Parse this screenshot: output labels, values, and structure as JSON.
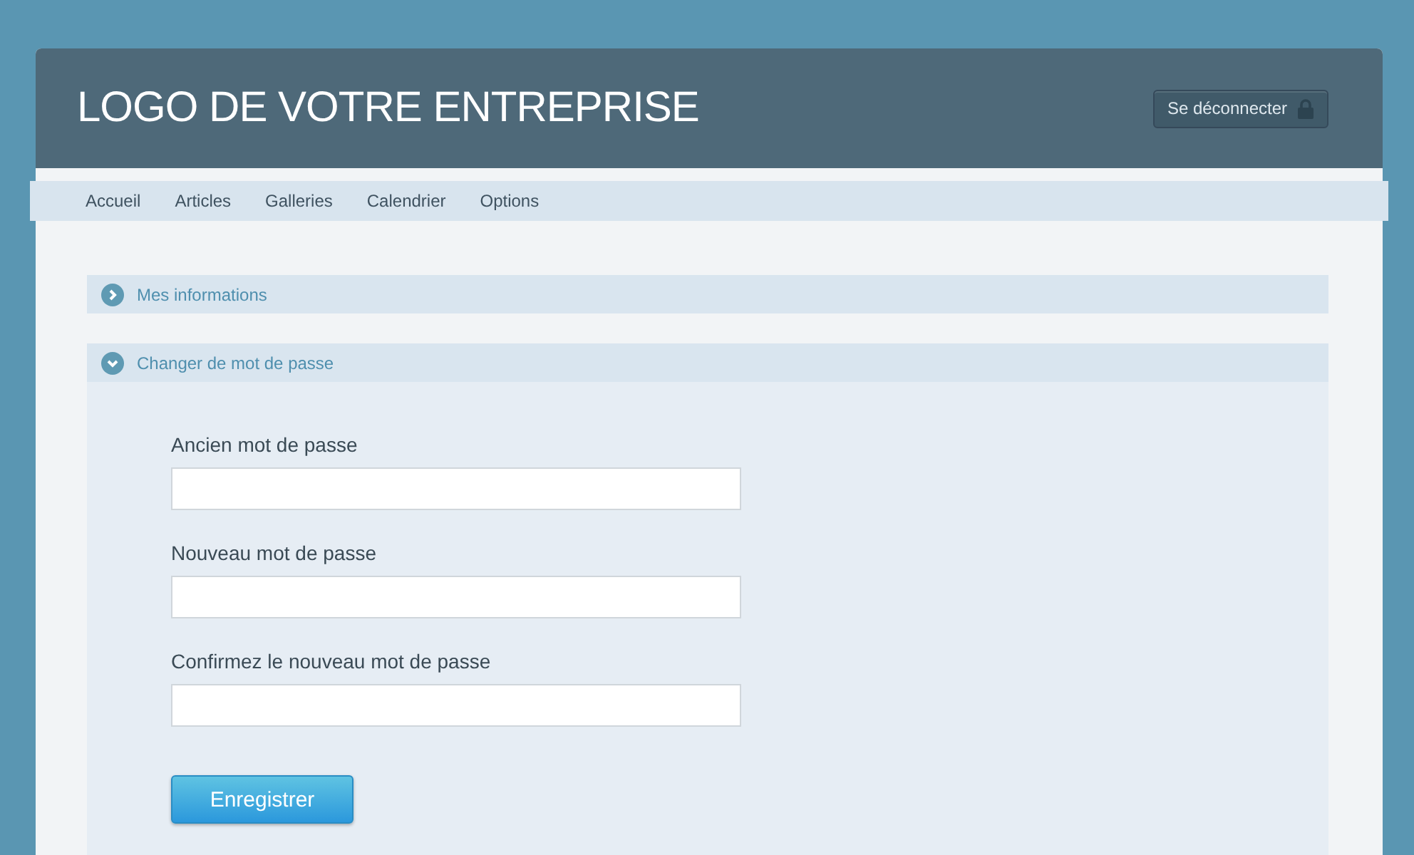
{
  "header": {
    "logo": "LOGO DE VOTRE ENTREPRISE",
    "logout_button": "Se déconnecter"
  },
  "nav": {
    "items": [
      "Accueil",
      "Articles",
      "Galleries",
      "Calendrier",
      "Options"
    ]
  },
  "sections": [
    {
      "title": "Mes informations",
      "expanded": false
    },
    {
      "title": "Changer de mot de passe",
      "expanded": true,
      "fields": [
        {
          "label": "Ancien mot de passe"
        },
        {
          "label": "Nouveau mot de passe"
        },
        {
          "label": "Confirmez le nouveau mot de passe"
        }
      ],
      "submit_button": "Enregistrer"
    }
  ]
}
